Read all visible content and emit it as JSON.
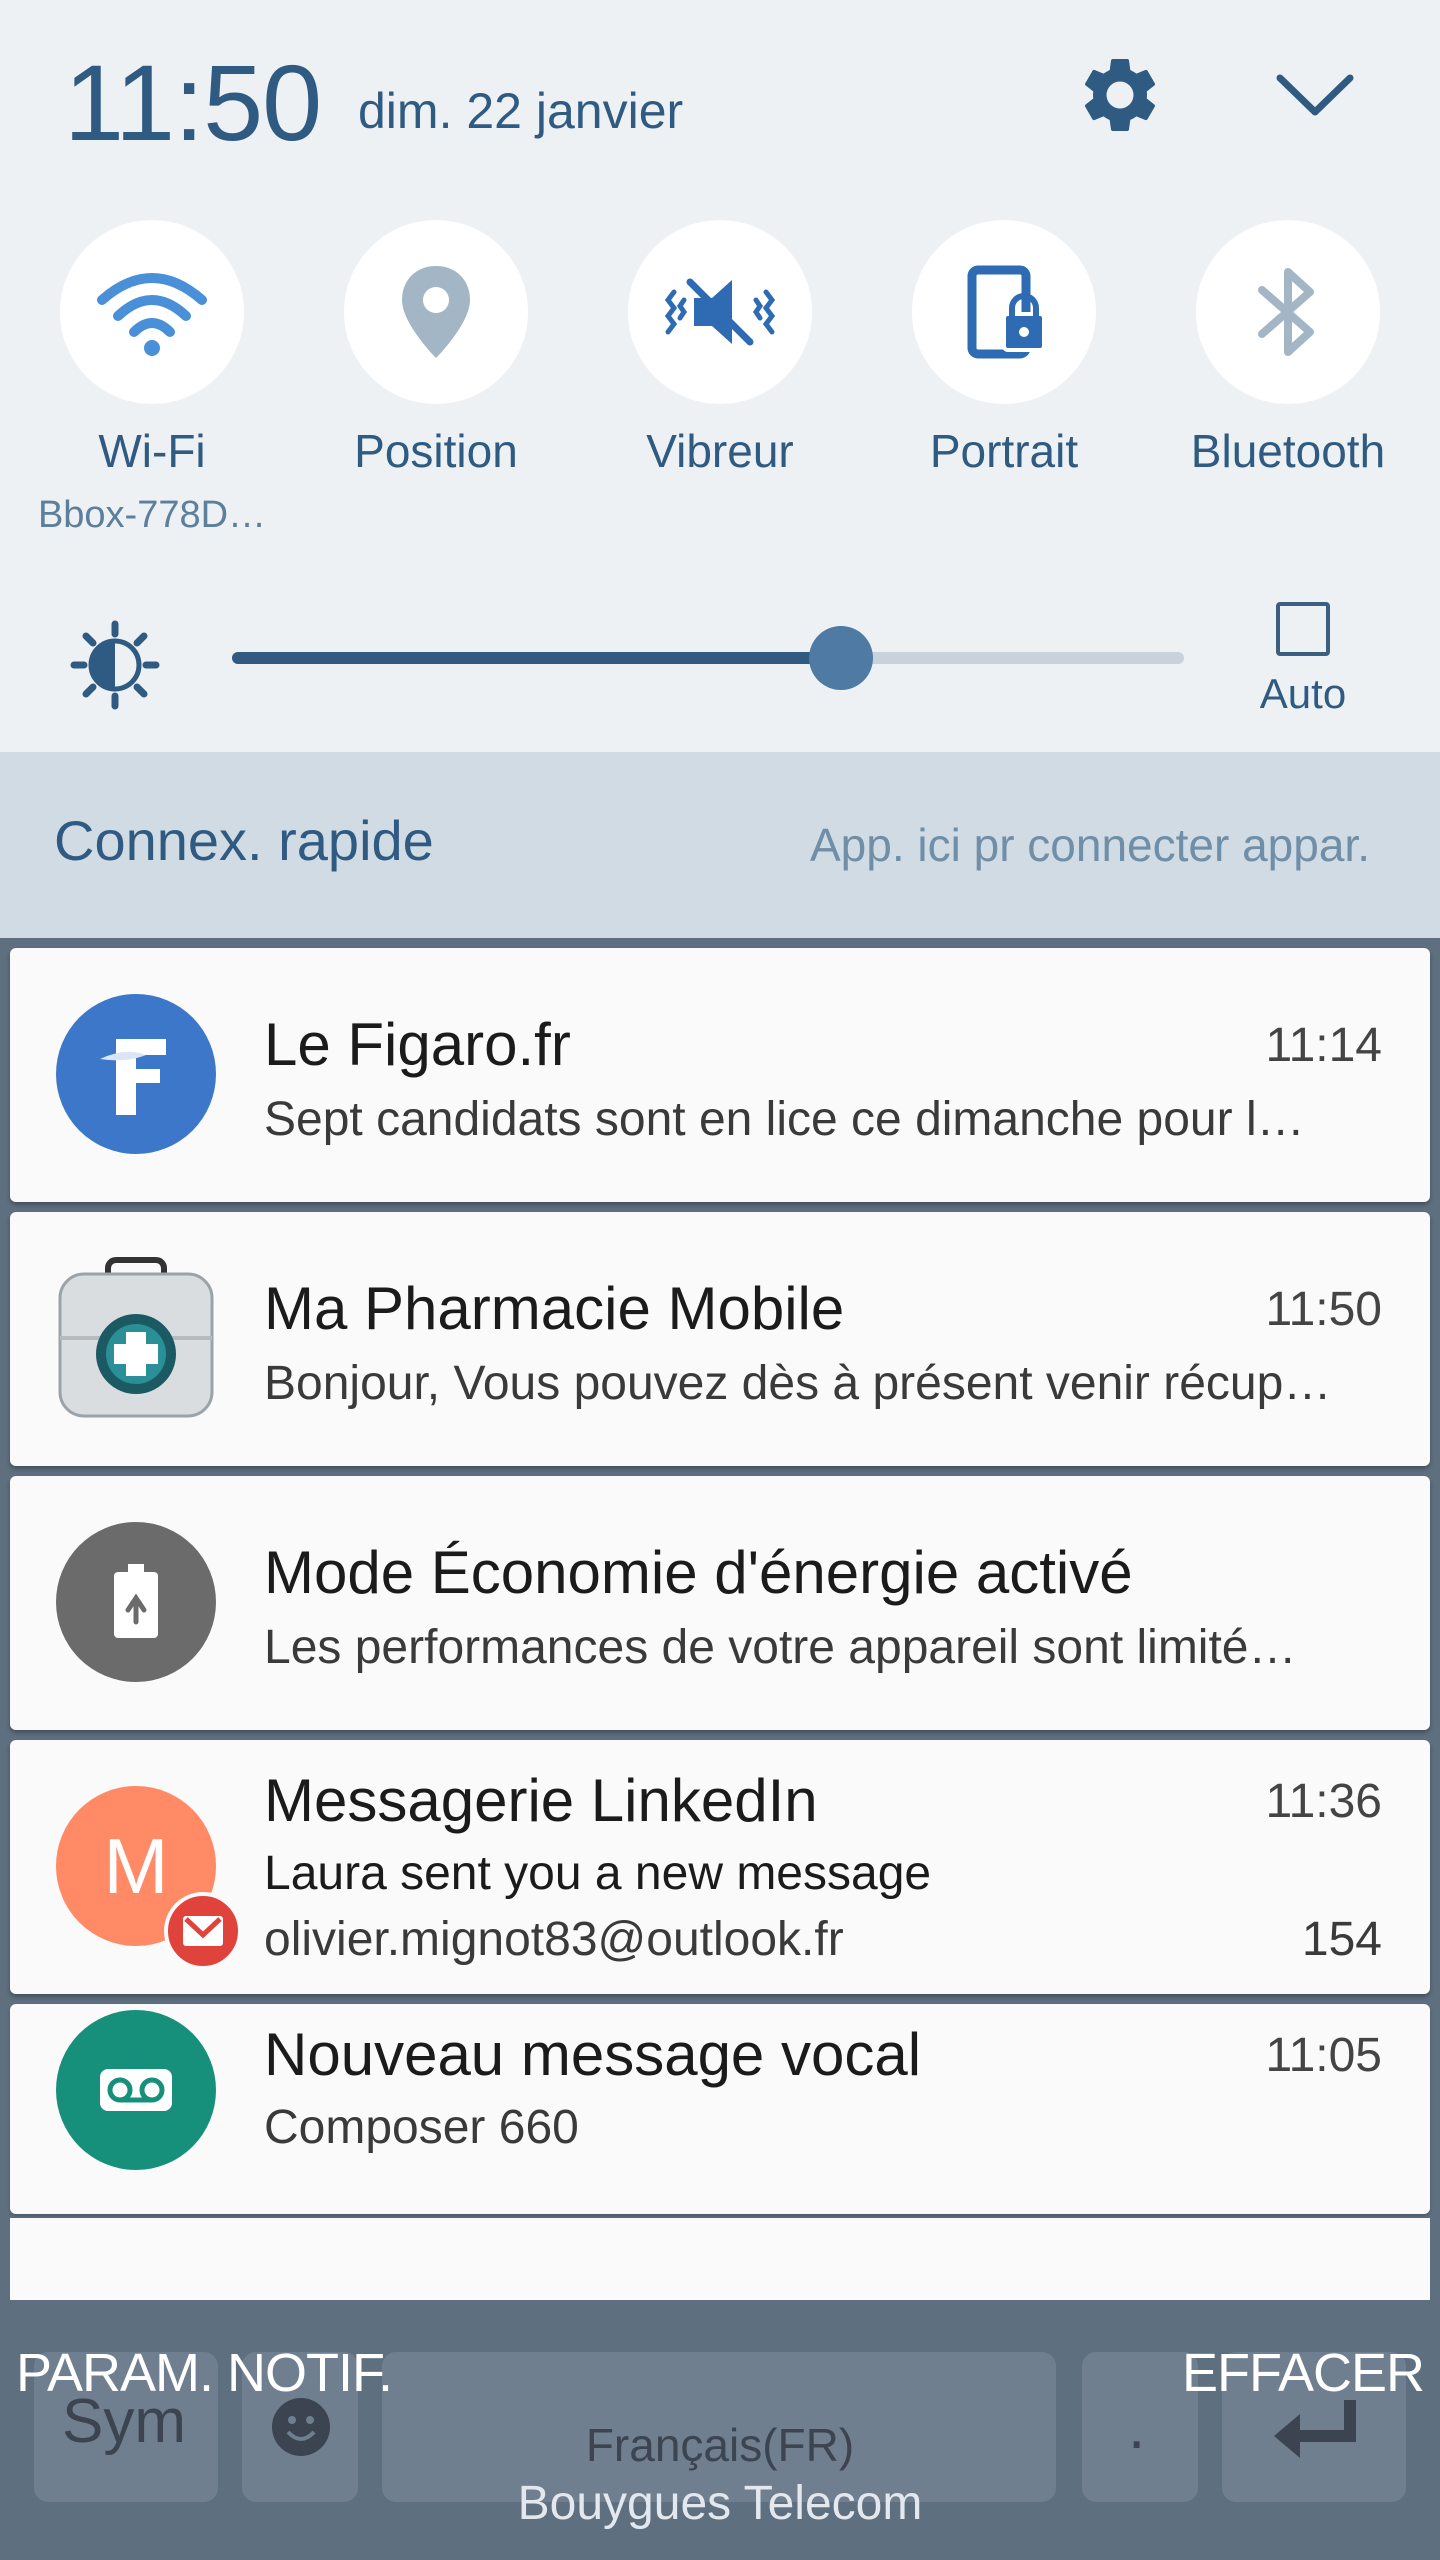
{
  "status": {
    "time": "11:50",
    "date": "dim. 22 janvier"
  },
  "quick_toggles": [
    {
      "label": "Wi-Fi",
      "sub": "Bbox-778D…",
      "icon": "wifi-icon"
    },
    {
      "label": "Position",
      "sub": "",
      "icon": "location-pin-icon"
    },
    {
      "label": "Vibreur",
      "sub": "",
      "icon": "vibrate-icon"
    },
    {
      "label": "Portrait",
      "sub": "",
      "icon": "portrait-lock-icon"
    },
    {
      "label": "Bluetooth",
      "sub": "",
      "icon": "bluetooth-icon"
    }
  ],
  "brightness": {
    "level": 0.64,
    "auto_label": "Auto",
    "auto_checked": false
  },
  "quick_connect": {
    "title": "Connex. rapide",
    "hint": "App. ici pr connecter appar."
  },
  "notifications": [
    {
      "app": "Le Figaro.fr",
      "time": "11:14",
      "text": "Sept candidats sont en lice ce dimanche pour l…",
      "icon": "figaro-icon",
      "color": "#3d77c9"
    },
    {
      "app": "Ma Pharmacie Mobile",
      "time": "11:50",
      "text": "Bonjour, Vous pouvez dès à présent venir récup…",
      "icon": "pharmacy-kit-icon",
      "color": "#d9dde0"
    },
    {
      "app": "Mode Économie d'énergie activé",
      "time": "",
      "text": "Les performances de votre appareil sont limité…",
      "icon": "battery-saver-icon",
      "color": "#6b6b6b"
    },
    {
      "app": "Messagerie LinkedIn",
      "time": "11:36",
      "text": "Laura sent you a new message",
      "account": "olivier.mignot83@outlook.fr",
      "count": "154",
      "icon": "avatar-letter-icon",
      "avatar_letter": "M",
      "color": "#ff8a65"
    },
    {
      "app": "Nouveau message vocal",
      "time": "11:05",
      "text": "Composer 660",
      "icon": "voicemail-icon",
      "color": "#16907a"
    }
  ],
  "bottom_bar": {
    "settings_label": "PARAM. NOTIF.",
    "clear_label": "EFFACER",
    "carrier": "Bouygues Telecom",
    "keyboard_sym": "Sym",
    "keyboard_lang": "Français(FR)",
    "keyboard_dot": "."
  }
}
